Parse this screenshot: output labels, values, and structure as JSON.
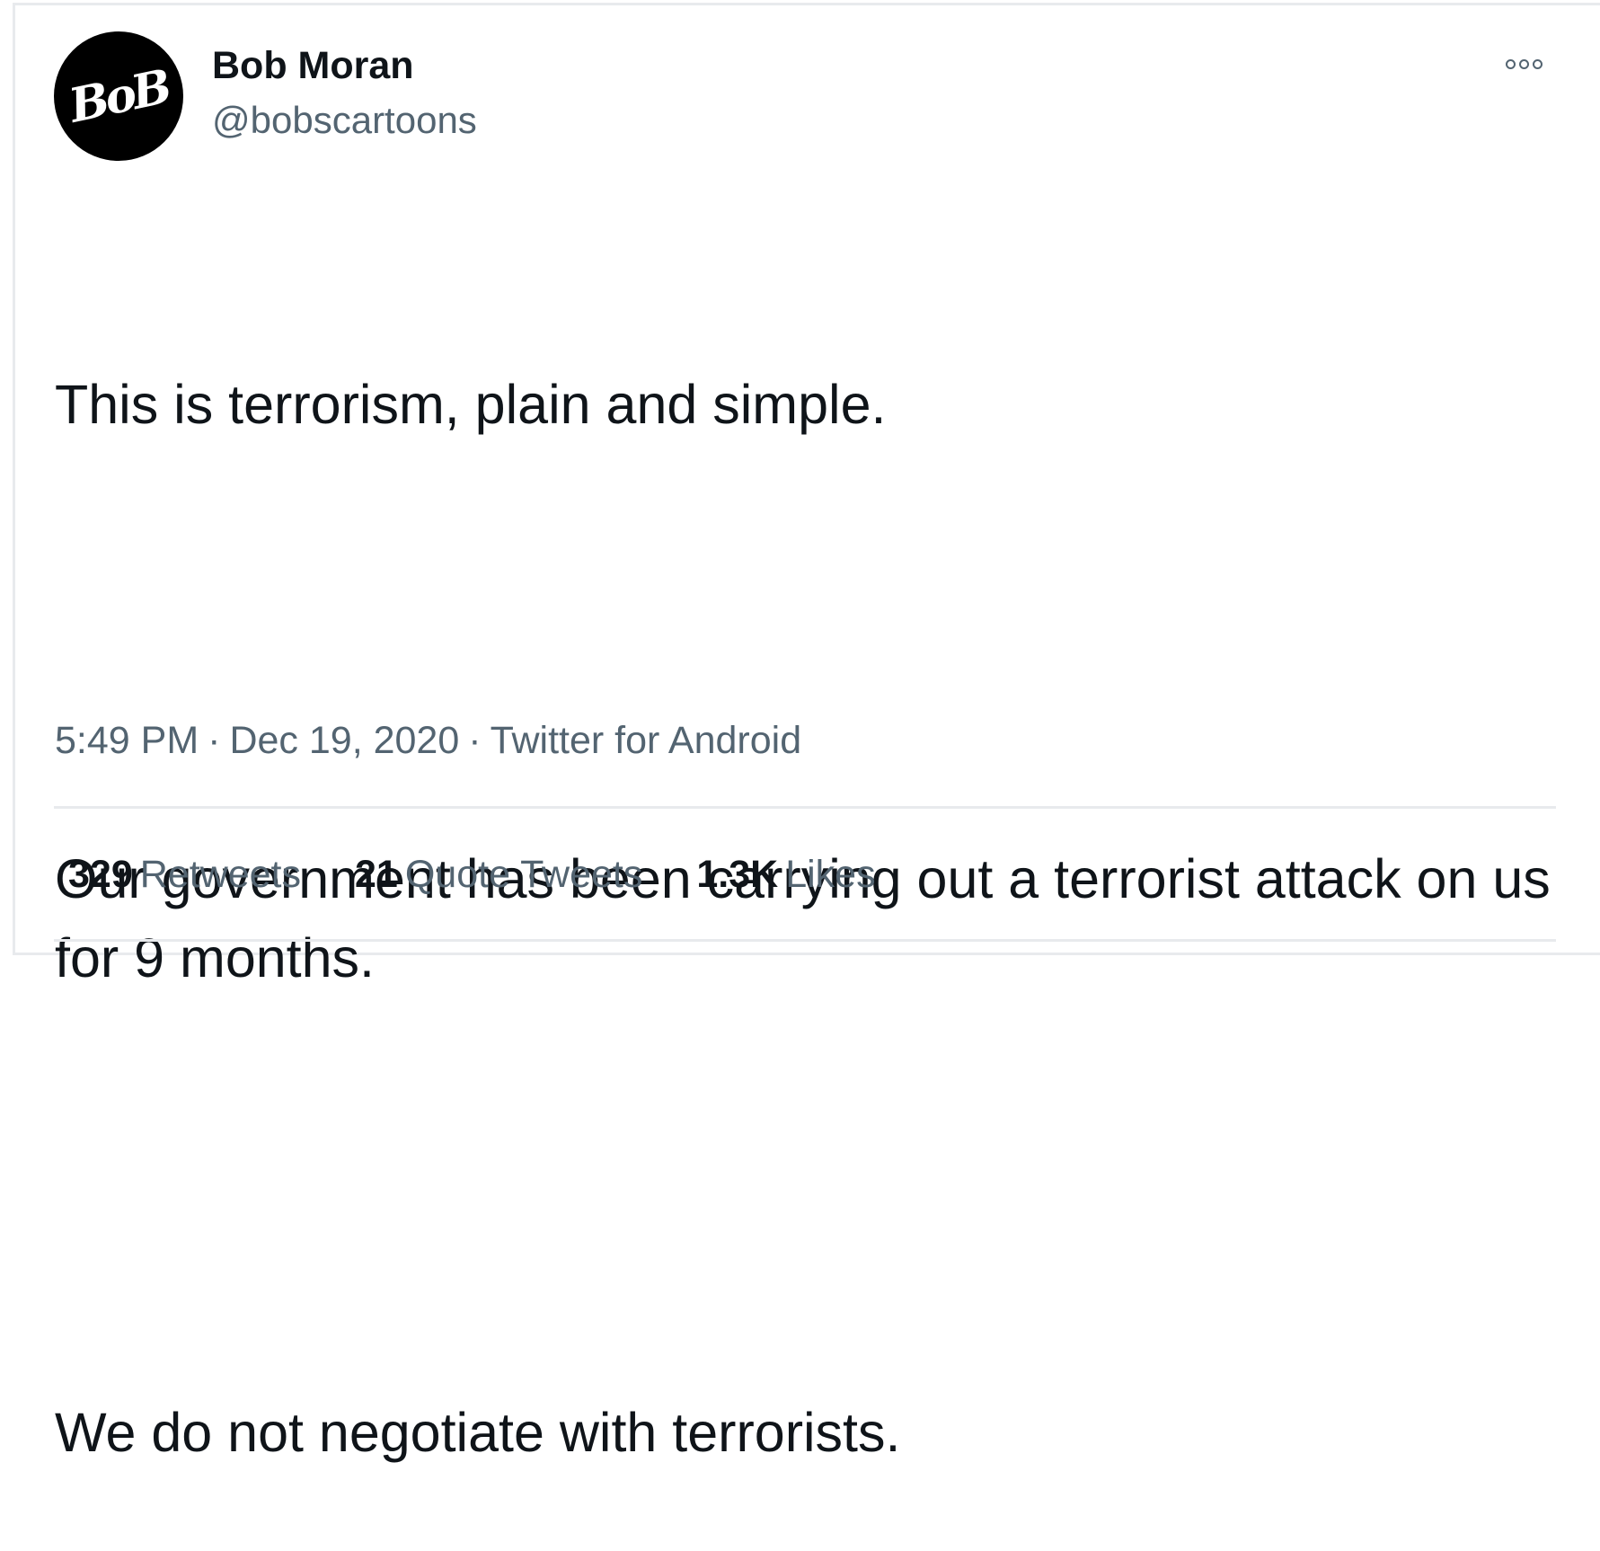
{
  "author": {
    "name": "Bob Moran",
    "handle": "@bobscartoons",
    "avatar_text": "BoB"
  },
  "tweet": {
    "paragraphs": [
      "This is terrorism, plain and simple.",
      "Our government has been carrying out a terrorist attack on us for 9 months.",
      "We do not negotiate with terrorists."
    ],
    "time": "5:49 PM",
    "date": "Dec 19, 2020",
    "source": "Twitter for Android",
    "separator": "·"
  },
  "stats": {
    "retweets": {
      "count": "329",
      "label": "Retweets"
    },
    "quote_tweets": {
      "count": "21",
      "label": "Quote Tweets"
    },
    "likes": {
      "count": "1.3K",
      "label": "Likes"
    }
  },
  "icons": {
    "more": "more-options-icon"
  },
  "colors": {
    "text_primary": "#0f1419",
    "text_secondary": "#536471",
    "border": "#e8eaed"
  }
}
